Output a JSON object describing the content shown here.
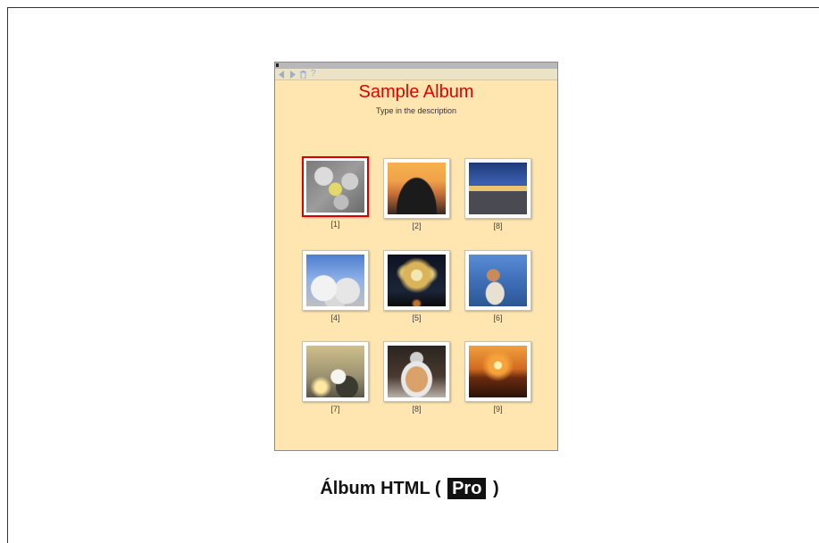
{
  "album": {
    "title": "Sample Album",
    "description": "Type in the description"
  },
  "toolbar": {
    "icons": [
      "back-arrow-icon",
      "forward-arrow-icon",
      "trash-icon",
      "help-icon"
    ],
    "help_label": "?"
  },
  "thumbnails": [
    {
      "caption": "[1]",
      "subject": "flowers-bird",
      "selected": true
    },
    {
      "caption": "[2]",
      "subject": "bridge-sunset",
      "selected": false
    },
    {
      "caption": "[8]",
      "subject": "night-harbor",
      "selected": false
    },
    {
      "caption": "[4]",
      "subject": "snowy-trees",
      "selected": false
    },
    {
      "caption": "[5]",
      "subject": "fireworks",
      "selected": false
    },
    {
      "caption": "[6]",
      "subject": "deer-lake",
      "selected": false
    },
    {
      "caption": "[7]",
      "subject": "heron-shore",
      "selected": false
    },
    {
      "caption": "[8]",
      "subject": "teapot-dessert",
      "selected": false
    },
    {
      "caption": "[9]",
      "subject": "ocean-sunset",
      "selected": false
    }
  ],
  "footer": {
    "prefix": "Álbum HTML (",
    "badge": "Pro",
    "suffix": ")"
  },
  "colors": {
    "album_bg": "#ffe6b0",
    "title": "#e60000",
    "selected_border": "#d50000"
  }
}
